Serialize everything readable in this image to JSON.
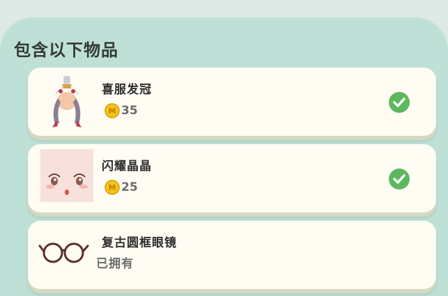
{
  "section": {
    "title": "包含以下物品"
  },
  "items": [
    {
      "name": "喜服发冠",
      "price": "35",
      "icon": "hair-crown-icon",
      "selected": true
    },
    {
      "name": "闪耀晶晶",
      "price": "25",
      "icon": "sparkle-face-icon",
      "selected": true
    },
    {
      "name": "复古圆框眼镜",
      "status": "已拥有",
      "icon": "round-glasses-icon",
      "selected": false
    }
  ],
  "colors": {
    "panel": "#bfe0d6",
    "card": "#fffdf3",
    "check": "#5cb85c",
    "coin": "#f5c518"
  }
}
